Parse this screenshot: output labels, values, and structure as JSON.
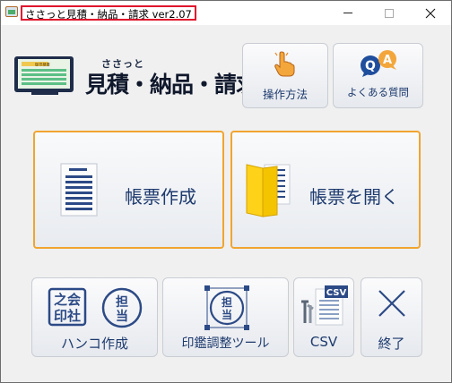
{
  "window": {
    "title": "ささっと見積・納品・請求 ver2.07"
  },
  "brand": {
    "small": "ささっと",
    "big": "見積・納品・請求"
  },
  "topButtons": {
    "howto": "操作方法",
    "faq": "よくある質問"
  },
  "mainButtons": {
    "create": "帳票作成",
    "open": "帳票を開く"
  },
  "bottomButtons": {
    "hanko": "ハンコ作成",
    "stamp": "印鑑調整ツール",
    "csv": "CSV",
    "exit": "終了"
  },
  "icons": {
    "hanko_seal_top": "之会",
    "hanko_seal_bottom": "印社",
    "hanko_round_top": "担",
    "hanko_round_bottom": "当",
    "csv_badge": "CSV",
    "logo_sheet": "御見積書",
    "faq_q": "Q",
    "faq_a": "A"
  },
  "colors": {
    "accent_orange": "#f0a530",
    "label_navy": "#1e3a6e",
    "title_outline": "#e0142c"
  }
}
